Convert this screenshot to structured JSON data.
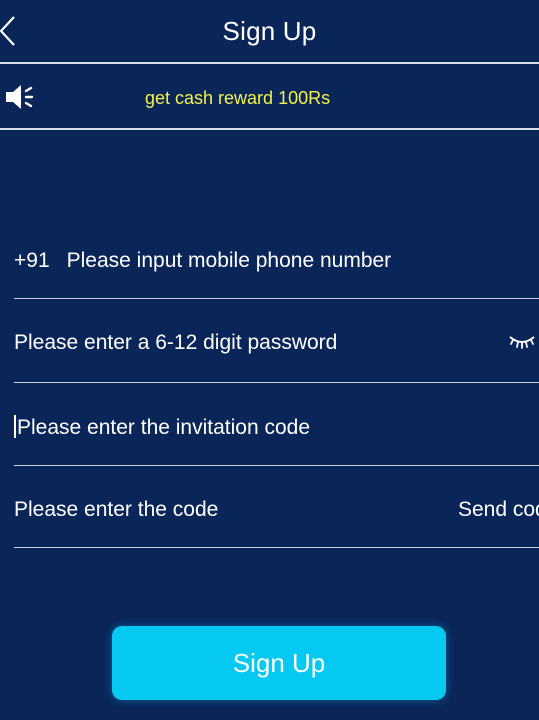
{
  "header": {
    "title": "Sign Up",
    "back_icon": "chevron-left-icon"
  },
  "notice": {
    "icon": "speaker-icon",
    "text": "get cash reward 100Rs",
    "text_color": "#f4f14a"
  },
  "form": {
    "phone": {
      "prefix": "+91",
      "placeholder": "Please input mobile phone number"
    },
    "password": {
      "placeholder": "Please enter a 6-12 digit password",
      "visibility_icon": "eye-closed-icon"
    },
    "invitation": {
      "placeholder": "Please enter the invitation code"
    },
    "code": {
      "placeholder": "Please enter the code",
      "send_label": "Send code"
    }
  },
  "submit": {
    "label": "Sign Up",
    "color": "#06c9f1"
  },
  "colors": {
    "background": "#0a2557",
    "divider": "#d7dde8"
  }
}
